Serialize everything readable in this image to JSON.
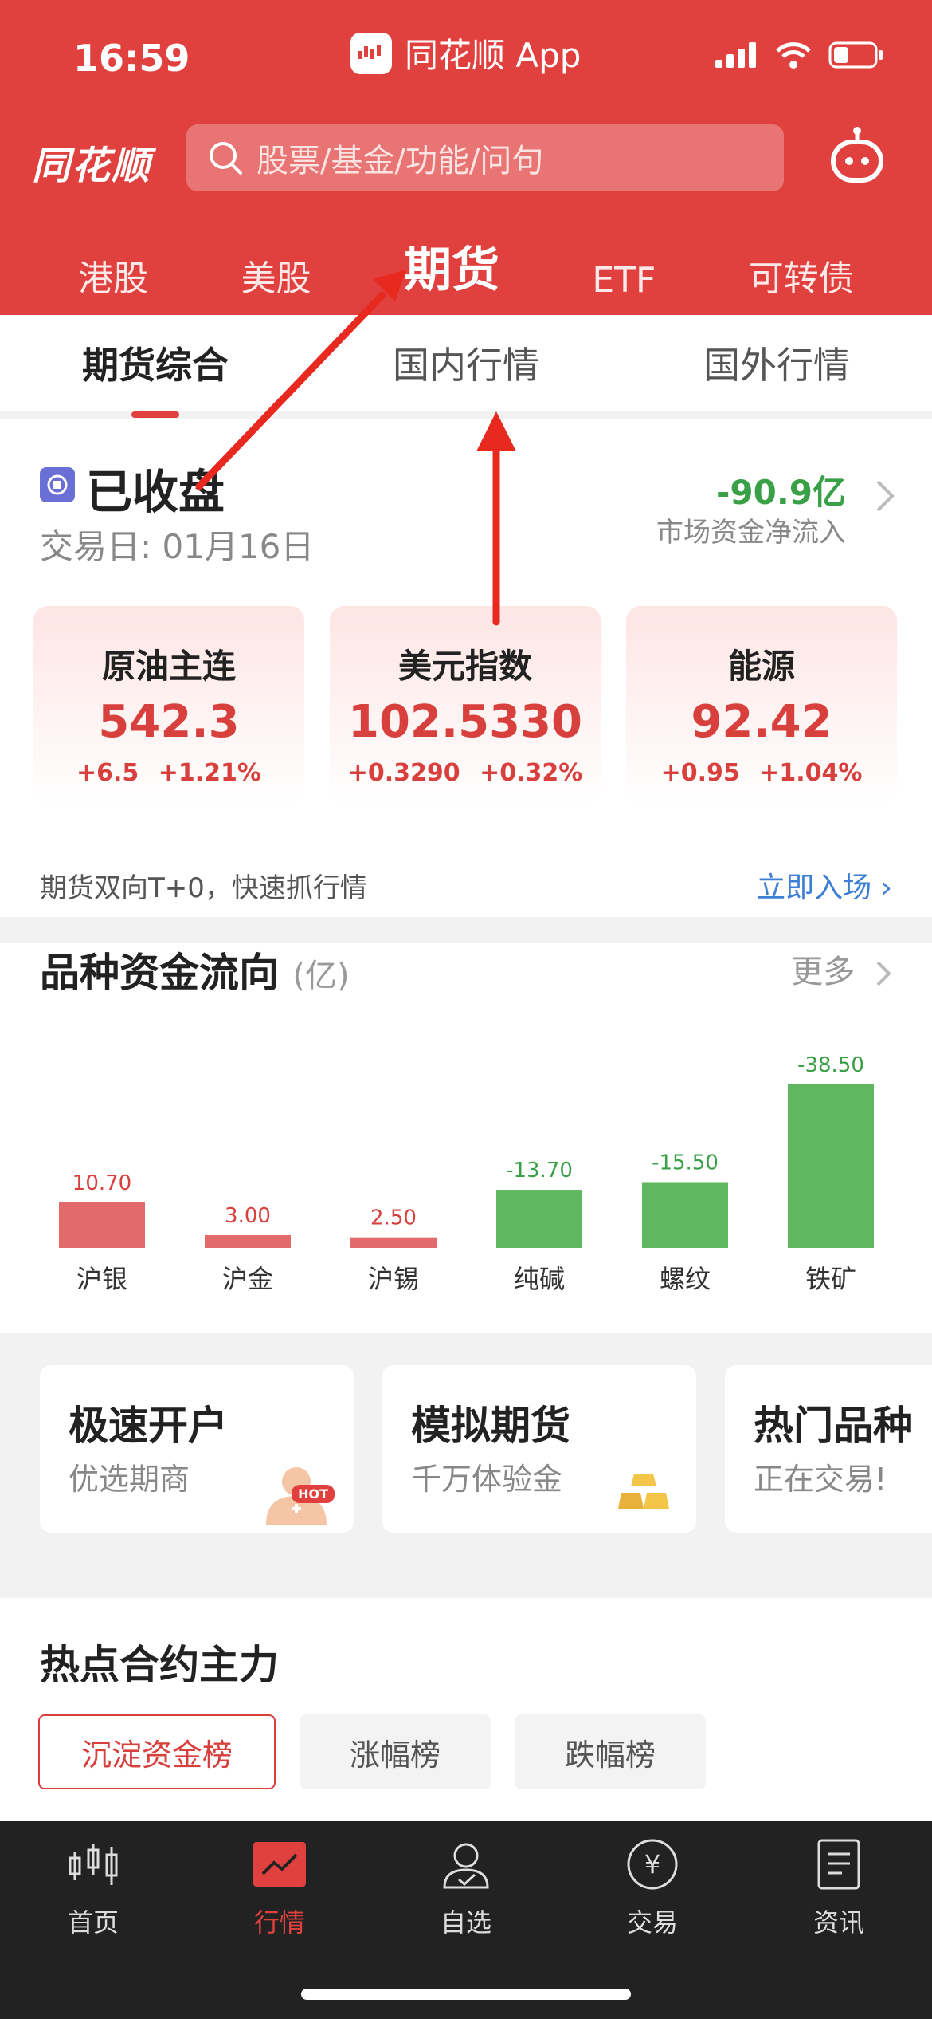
{
  "status_bar": {
    "time": "16:59",
    "app_title": "同花顺 App"
  },
  "header": {
    "logo": "同花顺",
    "search_placeholder": "股票/基金/功能/问句",
    "market_tabs": [
      "港股",
      "美股",
      "期货",
      "ETF",
      "可转债"
    ],
    "active_market_tab": "期货"
  },
  "sub_tabs": {
    "items": [
      "期货综合",
      "国内行情",
      "国外行情"
    ],
    "active": "期货综合"
  },
  "overview": {
    "status": "已收盘",
    "trade_date": "交易日: 01月16日",
    "net_flow_value": "-90.9亿",
    "net_flow_label": "市场资金净流入",
    "cards": [
      {
        "name": "原油主连",
        "value": "542.3",
        "change": "+6.5",
        "pct": "+1.21%"
      },
      {
        "name": "美元指数",
        "value": "102.5330",
        "change": "+0.3290",
        "pct": "+0.32%"
      },
      {
        "name": "能源",
        "value": "92.42",
        "change": "+0.95",
        "pct": "+1.04%"
      }
    ],
    "promo_text": "期货双向T+0，快速抓行情",
    "promo_link": "立即入场"
  },
  "flow_section": {
    "title": "品种资金流向",
    "unit": "(亿)",
    "more": "更多"
  },
  "chart_data": {
    "type": "bar",
    "categories": [
      "沪银",
      "沪金",
      "沪锡",
      "纯碱",
      "螺纹",
      "铁矿"
    ],
    "values": [
      10.7,
      3.0,
      2.5,
      -13.7,
      -15.5,
      -38.5
    ],
    "value_labels": [
      "10.70",
      "3.00",
      "2.50",
      "-13.70",
      "-15.50",
      "-38.50"
    ],
    "positive_color": "#e36a6a",
    "negative_color": "#5fb85f",
    "bar_height_by": "absolute value"
  },
  "quick_cards": [
    {
      "title": "极速开户",
      "subtitle": "优选期商",
      "badge": "HOT"
    },
    {
      "title": "模拟期货",
      "subtitle": "千万体验金"
    },
    {
      "title": "热门品种",
      "subtitle": "正在交易!"
    }
  ],
  "hot_section": {
    "title": "热点合约主力",
    "buttons": [
      "沉淀资金榜",
      "涨幅榜",
      "跌幅榜"
    ],
    "active_button": "沉淀资金榜"
  },
  "bottom_nav": {
    "items": [
      "首页",
      "行情",
      "自选",
      "交易",
      "资讯"
    ],
    "active": "行情"
  },
  "colors": {
    "brand_red": "#e0413f",
    "up_red": "#d8403d",
    "down_green": "#3aa047",
    "link_blue": "#3d7fd6"
  }
}
